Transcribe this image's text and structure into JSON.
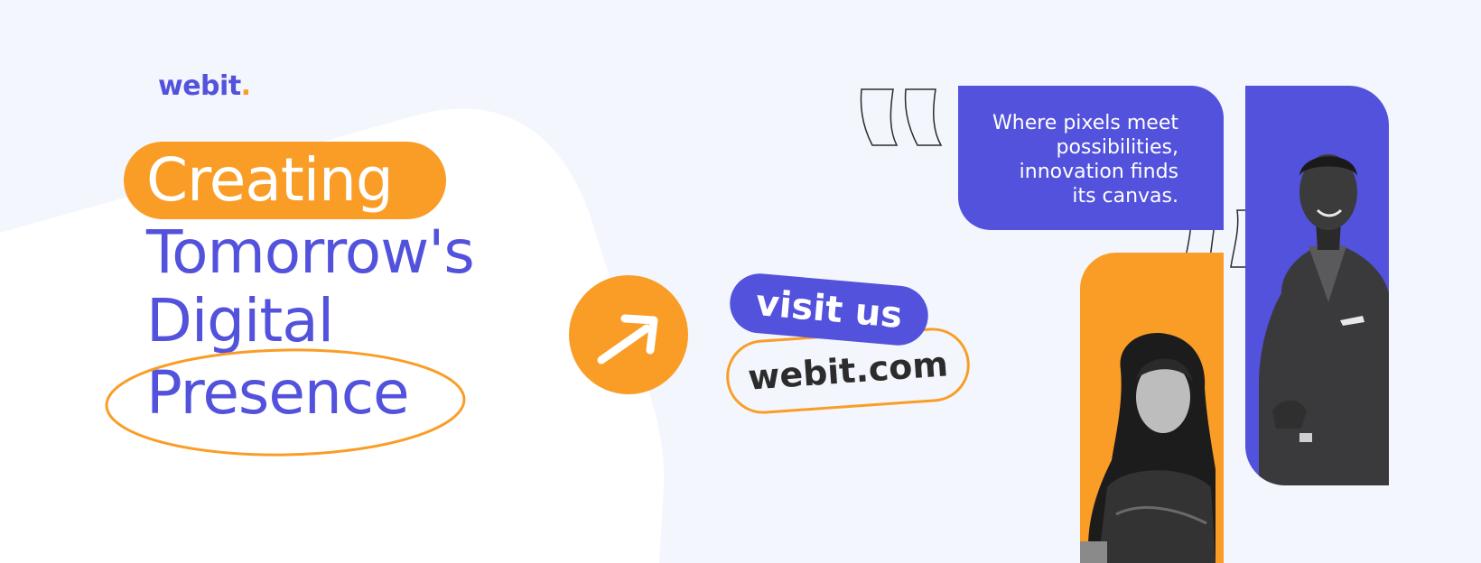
{
  "brand": {
    "name": "webit",
    "dot": "."
  },
  "headline": {
    "line1": "Creating",
    "line2": "Tomorrow's",
    "line3": "Digital",
    "line4": "Presence"
  },
  "cta": {
    "visit_label": "visit us",
    "url_label": "webit.com"
  },
  "quote": {
    "line1": "Where pixels meet",
    "line2": "possibilities,",
    "line3": "innovation finds",
    "line4": "its canvas."
  },
  "icons": [
    "arrow-up-right-icon",
    "open-quote-icon",
    "close-quote-icon"
  ],
  "colors": {
    "primary": "#5352dc",
    "accent": "#fa9d26",
    "background": "#f3f6fc",
    "surface": "#ffffff"
  }
}
